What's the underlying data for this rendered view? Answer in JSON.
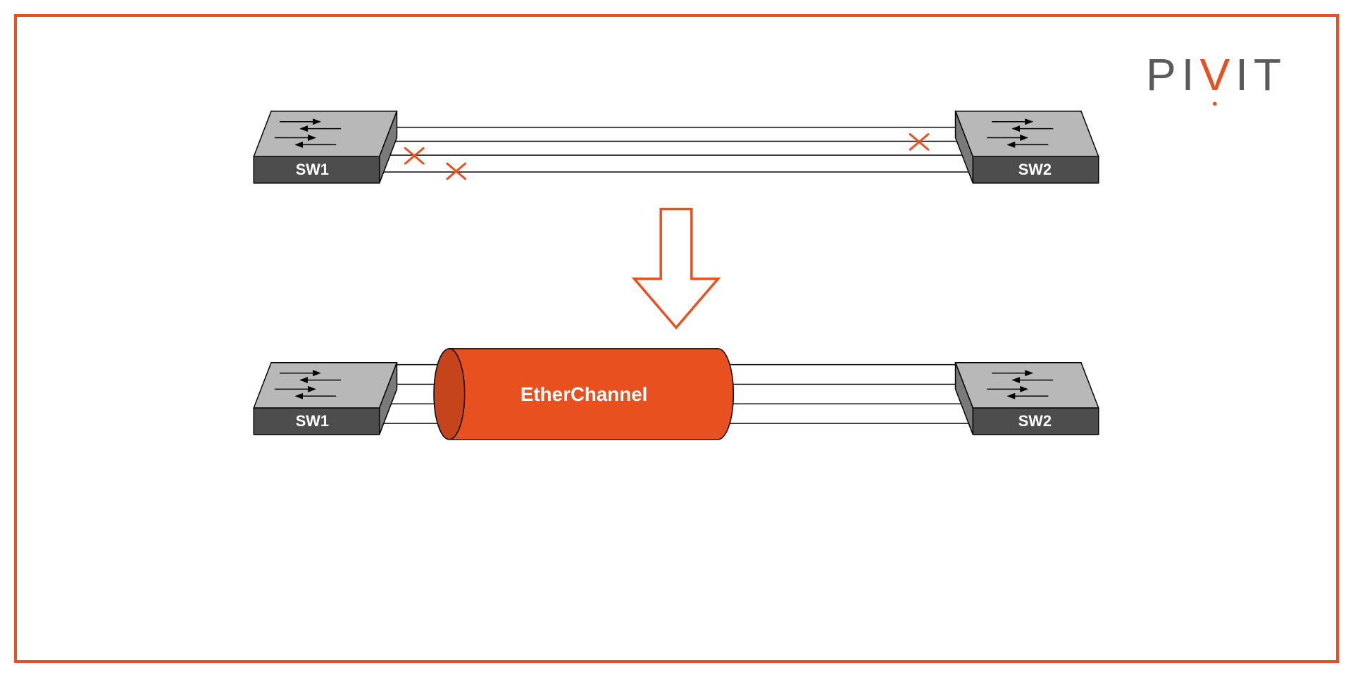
{
  "logo": {
    "p1": "P",
    "i1": "I",
    "v": "V",
    "i2": "I",
    "t": "T"
  },
  "diagram": {
    "top": {
      "switch_left": "SW1",
      "switch_right": "SW2"
    },
    "bottom": {
      "switch_left": "SW1",
      "switch_right": "SW2",
      "channel_label": "EtherChannel"
    }
  },
  "colors": {
    "accent": "#E8501F",
    "gray_text": "#5A5A5A",
    "switch_top": "#B8B8B8",
    "switch_front": "#4D4D4D",
    "black": "#000"
  }
}
